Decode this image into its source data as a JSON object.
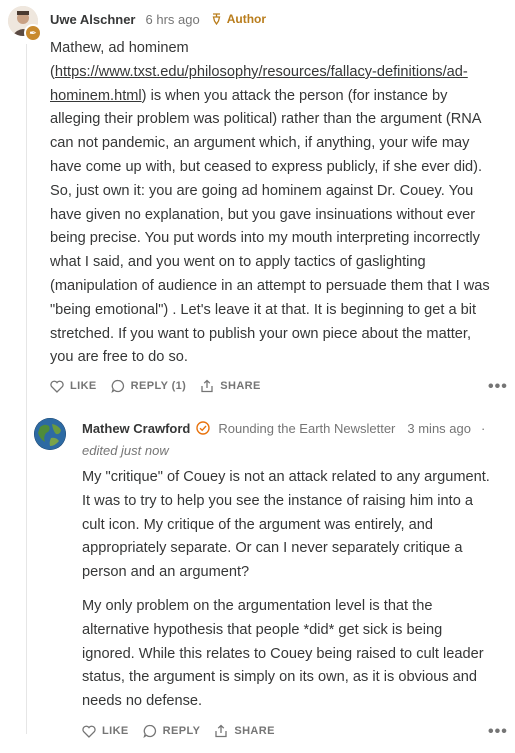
{
  "comment1": {
    "author": "Uwe Alschner",
    "time": "6 hrs ago",
    "badge": "Author",
    "lines": [
      "Mathew, ad hominem",
      "(https://www.txst.edu/philosophy/resources/fallacy-definitions/ad-",
      "hominem.html) is when you attack the person (for instance by",
      "alleging their problem was political) rather than the argument (RNA",
      "can not pandemic, an argument which, if anything, your wife may",
      "have come up with, but ceased to express publicly, if she ever did).",
      "So, just own it: you are going ad hominem against Dr. Couey. You",
      "have given no explanation, but you gave insinuations without ever",
      "being precise. You put words into my mouth interpreting incorrectly",
      "what I said, and you went on to apply tactics of gaslighting",
      "(manipulation of audience in an attempt to persuade them that I was",
      "\"being emotional\") . Let's leave it at that. It is beginning to get a bit",
      "stretched. If you want to publish your own piece about the matter,",
      "you are free to do so."
    ],
    "link_part1": "https://www.txst.edu/philosophy/resources/fallacy-definitions/ad-",
    "link_part2": "hominem.html",
    "actions": {
      "like": "LIKE",
      "reply": "REPLY (1)",
      "share": "SHARE"
    }
  },
  "comment2": {
    "author": "Mathew Crawford",
    "publication": "Rounding the Earth Newsletter",
    "time": "3 mins ago",
    "dot": "·",
    "edited": "edited just now",
    "para1": [
      "My \"critique\" of Couey is not an attack related to any argument.",
      "It was to try to help you see the instance of raising him into a",
      "cult icon. My critique of the argument was entirely, and",
      "appropriately separate. Or can I never separately critique a",
      "person and an argument?"
    ],
    "para2": [
      "My only problem on the argumentation level is that the",
      "alternative hypothesis that people *did* get sick is being",
      "ignored. While this relates to Couey being raised to cult leader",
      "status, the argument is simply on its own, as it is obvious and",
      "needs no defense."
    ],
    "actions": {
      "like": "LIKE",
      "reply": "REPLY",
      "share": "SHARE"
    }
  },
  "more_label": "•••",
  "colors": {
    "author_badge": "#b97d1c",
    "check": "#e8730e",
    "text": "#363737",
    "muted": "#757575"
  }
}
